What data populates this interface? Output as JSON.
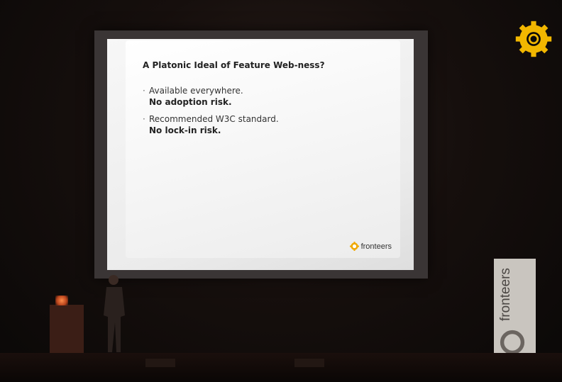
{
  "slide": {
    "title": "A Platonic Ideal of Feature Web-ness?",
    "bullets": [
      {
        "line1": "Available everywhere.",
        "line2": "No adoption risk."
      },
      {
        "line1": "Recommended W3C standard.",
        "line2": "No lock-in risk."
      }
    ],
    "logo_text": "fronteers"
  },
  "banner": {
    "text": "fronteers"
  },
  "colors": {
    "brand_orange": "#f0a800",
    "slide_text": "#222222",
    "stage_dark": "#0c0a09"
  },
  "icons": [
    "fronteers-gear-icon"
  ]
}
